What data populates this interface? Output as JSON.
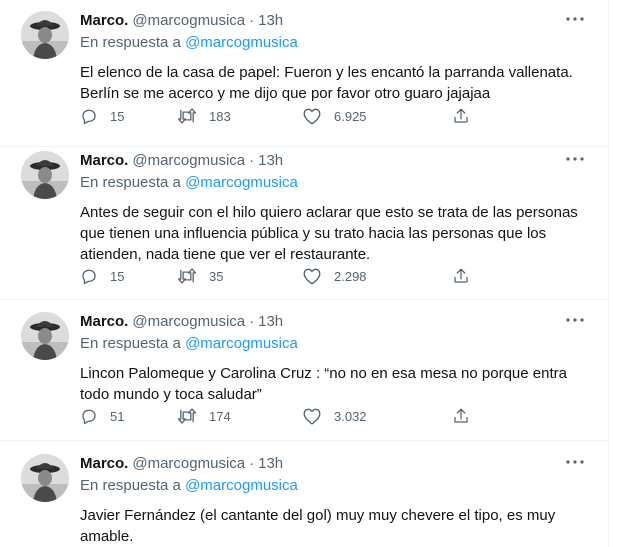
{
  "tweets": [
    {
      "name": "Marco.",
      "handle": "@marcogmusica",
      "separator": "·",
      "time": "13h",
      "reply_prefix": "En respuesta a ",
      "reply_mention": "@marcogmusica",
      "text": "El elenco de la casa de papel: Fueron y les encantó la parranda vallenata.\nBerlín se me acerco y me dijo que por favor otro guaro jajajaa",
      "replies": "15",
      "retweets": "183",
      "likes": "6.925"
    },
    {
      "name": "Marco.",
      "handle": "@marcogmusica",
      "separator": "·",
      "time": "13h",
      "reply_prefix": "En respuesta a ",
      "reply_mention": "@marcogmusica",
      "text": "Antes de seguir con el hilo quiero aclarar que esto se trata de las personas\nque tienen una influencia pública y su trato hacia las personas que los\natienden, nada tiene que ver el restaurante.",
      "replies": "15",
      "retweets": "35",
      "likes": "2.298"
    },
    {
      "name": "Marco.",
      "handle": "@marcogmusica",
      "separator": "·",
      "time": "13h",
      "reply_prefix": "En respuesta a ",
      "reply_mention": "@marcogmusica",
      "text": "Lincon Palomeque y Carolina Cruz : “no no en esa mesa no porque entra\ntodo mundo y toca saludar”",
      "replies": "51",
      "retweets": "174",
      "likes": "3.032"
    },
    {
      "name": "Marco.",
      "handle": "@marcogmusica",
      "separator": "·",
      "time": "13h",
      "reply_prefix": "En respuesta a ",
      "reply_mention": "@marcogmusica",
      "text": "Javier Fernández (el cantante del gol) muy muy chevere el tipo, es muy\namable."
    }
  ],
  "icons": {
    "more": "more-options-icon",
    "reply": "reply-icon",
    "retweet": "retweet-icon",
    "like": "like-icon",
    "share": "share-icon"
  },
  "colors": {
    "text": "#0f1419",
    "secondary": "#536471",
    "mention": "#1d9bf0",
    "divider": "#eff3f4"
  }
}
